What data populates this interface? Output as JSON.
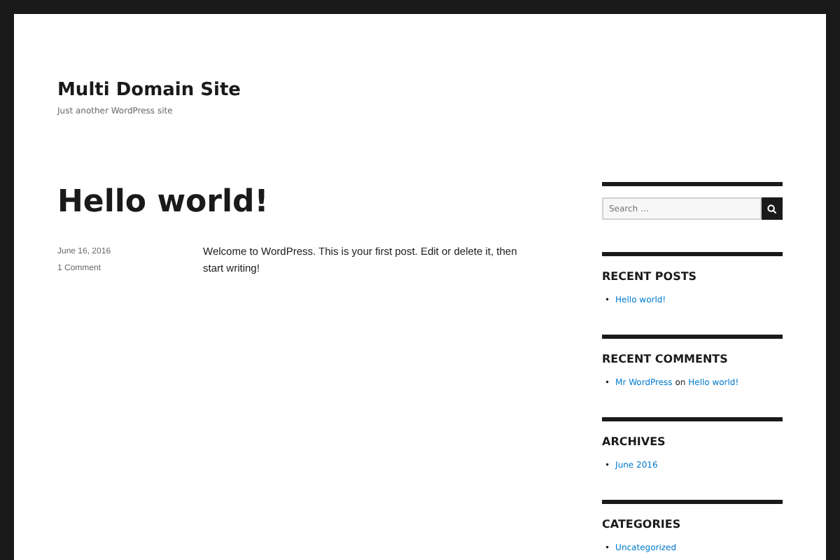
{
  "site": {
    "title": "Multi Domain Site",
    "tagline": "Just another WordPress site"
  },
  "post": {
    "title": "Hello world!",
    "date": "June 16, 2016",
    "comments": "1 Comment",
    "content": "Welcome to WordPress. This is your first post. Edit or delete it, then start writing!"
  },
  "sidebar": {
    "bullet": "•",
    "search": {
      "placeholder": "Search …"
    },
    "widgets": [
      {
        "kind": "links",
        "title": "RECENT POSTS",
        "items": [
          "Hello world!"
        ]
      },
      {
        "kind": "comments",
        "title": "RECENT COMMENTS",
        "items": [
          {
            "author": "Mr WordPress",
            "joiner": "on",
            "post": "Hello world!"
          }
        ]
      },
      {
        "kind": "links",
        "title": "ARCHIVES",
        "items": [
          "June 2016"
        ]
      },
      {
        "kind": "links",
        "title": "CATEGORIES",
        "items": [
          "Uncategorized"
        ]
      }
    ]
  }
}
